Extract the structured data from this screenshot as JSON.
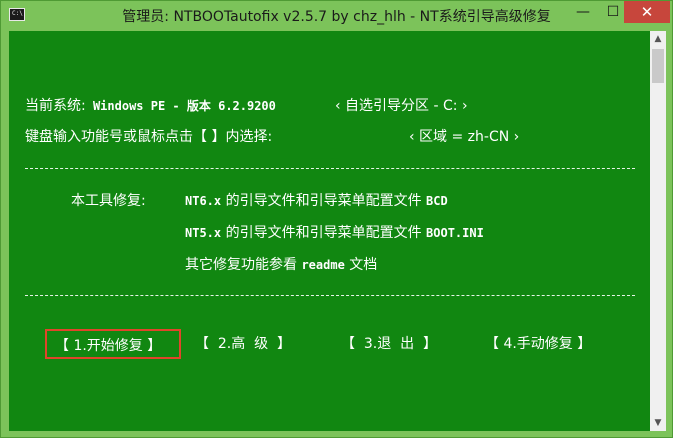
{
  "window": {
    "title": "管理员:  NTBOOTautofix v2.5.7 by chz_hlh - NT系统引导高级修复",
    "icon_label": "C:\\",
    "minimize_glyph": "—",
    "maximize_glyph": "☐",
    "close_glyph": "✕"
  },
  "console": {
    "system_label": "当前系统:",
    "system_value": " Windows PE - 版本 6.2.9200",
    "partition": "‹ 自选引导分区 - C: ›",
    "prompt": "键盘输入功能号或鼠标点击【 】内选择:",
    "region": "‹ 区域 = zh-CN ›",
    "tool_label": "本工具修复:",
    "nt6_prefix": "NT6.x",
    "nt6_text": " 的引导文件和引导菜单配置文件 ",
    "nt6_suffix": "BCD",
    "nt5_prefix": "NT5.x",
    "nt5_text": " 的引导文件和引导菜单配置文件 ",
    "nt5_suffix": "BOOT.INI",
    "other_text": "其它修复功能参看 ",
    "other_readme": "readme",
    "other_suffix": " 文档"
  },
  "menu": {
    "start": "【 1.开始修复 】",
    "advanced": "【  2.高  级  】",
    "exit": "【  3.退  出  】",
    "manual": "【 4.手动修复 】"
  },
  "scrollbar": {
    "up_glyph": "▲",
    "down_glyph": "▼"
  },
  "colors": {
    "console_bg": "#118711",
    "titlebar": "#7cc35a",
    "close_button": "#c7463c",
    "selection_border": "#e0452a"
  }
}
